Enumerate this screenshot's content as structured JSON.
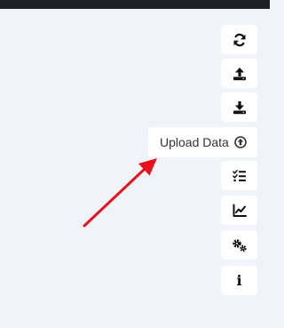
{
  "tooltip": {
    "label": "Upload Data",
    "icon": "arrow-circle-up-icon"
  },
  "sidebar": {
    "buttons": [
      {
        "name": "refresh-button",
        "icon": "refresh-icon"
      },
      {
        "name": "upload-button",
        "icon": "upload-icon"
      },
      {
        "name": "download-button",
        "icon": "download-icon"
      },
      {
        "name": "upload-data-button",
        "icon": "arrow-circle-up-icon"
      },
      {
        "name": "checklist-button",
        "icon": "checklist-icon"
      },
      {
        "name": "chart-button",
        "icon": "line-chart-icon"
      },
      {
        "name": "settings-button",
        "icon": "gears-icon"
      },
      {
        "name": "info-button",
        "icon": "info-icon",
        "glyph": "i"
      }
    ]
  },
  "colors": {
    "background": "#f0f3f8",
    "topbar": "#1d2027",
    "button": "#ffffff",
    "icon": "#111111",
    "annotation_arrow": "#e8121b"
  }
}
